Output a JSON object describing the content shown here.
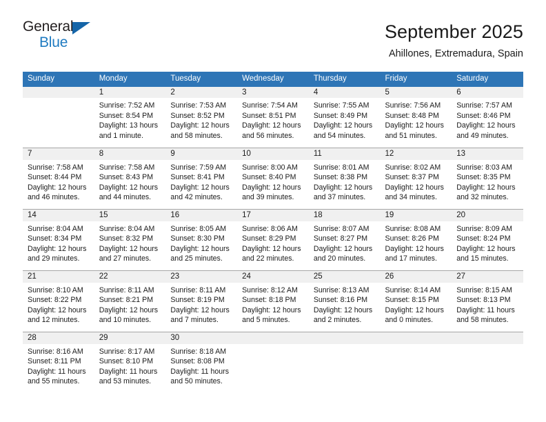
{
  "brand": {
    "line1": "General",
    "line2": "Blue",
    "triangle_icon": "triangle-logo-icon",
    "color_dark": "#231f20",
    "color_blue": "#1f7bc1"
  },
  "header": {
    "title": "September 2025",
    "subtitle": "Ahillones, Extremadura, Spain"
  },
  "colors": {
    "header_blue": "#2e75b6",
    "daynum_band": "#f0f0f0",
    "row_divider": "#a6a6a6"
  },
  "weekday_headers": [
    "Sunday",
    "Monday",
    "Tuesday",
    "Wednesday",
    "Thursday",
    "Friday",
    "Saturday"
  ],
  "weeks": [
    [
      {
        "day": "",
        "lines": []
      },
      {
        "day": "1",
        "lines": [
          "Sunrise: 7:52 AM",
          "Sunset: 8:54 PM",
          "Daylight: 13 hours",
          "and 1 minute."
        ]
      },
      {
        "day": "2",
        "lines": [
          "Sunrise: 7:53 AM",
          "Sunset: 8:52 PM",
          "Daylight: 12 hours",
          "and 58 minutes."
        ]
      },
      {
        "day": "3",
        "lines": [
          "Sunrise: 7:54 AM",
          "Sunset: 8:51 PM",
          "Daylight: 12 hours",
          "and 56 minutes."
        ]
      },
      {
        "day": "4",
        "lines": [
          "Sunrise: 7:55 AM",
          "Sunset: 8:49 PM",
          "Daylight: 12 hours",
          "and 54 minutes."
        ]
      },
      {
        "day": "5",
        "lines": [
          "Sunrise: 7:56 AM",
          "Sunset: 8:48 PM",
          "Daylight: 12 hours",
          "and 51 minutes."
        ]
      },
      {
        "day": "6",
        "lines": [
          "Sunrise: 7:57 AM",
          "Sunset: 8:46 PM",
          "Daylight: 12 hours",
          "and 49 minutes."
        ]
      }
    ],
    [
      {
        "day": "7",
        "lines": [
          "Sunrise: 7:58 AM",
          "Sunset: 8:44 PM",
          "Daylight: 12 hours",
          "and 46 minutes."
        ]
      },
      {
        "day": "8",
        "lines": [
          "Sunrise: 7:58 AM",
          "Sunset: 8:43 PM",
          "Daylight: 12 hours",
          "and 44 minutes."
        ]
      },
      {
        "day": "9",
        "lines": [
          "Sunrise: 7:59 AM",
          "Sunset: 8:41 PM",
          "Daylight: 12 hours",
          "and 42 minutes."
        ]
      },
      {
        "day": "10",
        "lines": [
          "Sunrise: 8:00 AM",
          "Sunset: 8:40 PM",
          "Daylight: 12 hours",
          "and 39 minutes."
        ]
      },
      {
        "day": "11",
        "lines": [
          "Sunrise: 8:01 AM",
          "Sunset: 8:38 PM",
          "Daylight: 12 hours",
          "and 37 minutes."
        ]
      },
      {
        "day": "12",
        "lines": [
          "Sunrise: 8:02 AM",
          "Sunset: 8:37 PM",
          "Daylight: 12 hours",
          "and 34 minutes."
        ]
      },
      {
        "day": "13",
        "lines": [
          "Sunrise: 8:03 AM",
          "Sunset: 8:35 PM",
          "Daylight: 12 hours",
          "and 32 minutes."
        ]
      }
    ],
    [
      {
        "day": "14",
        "lines": [
          "Sunrise: 8:04 AM",
          "Sunset: 8:34 PM",
          "Daylight: 12 hours",
          "and 29 minutes."
        ]
      },
      {
        "day": "15",
        "lines": [
          "Sunrise: 8:04 AM",
          "Sunset: 8:32 PM",
          "Daylight: 12 hours",
          "and 27 minutes."
        ]
      },
      {
        "day": "16",
        "lines": [
          "Sunrise: 8:05 AM",
          "Sunset: 8:30 PM",
          "Daylight: 12 hours",
          "and 25 minutes."
        ]
      },
      {
        "day": "17",
        "lines": [
          "Sunrise: 8:06 AM",
          "Sunset: 8:29 PM",
          "Daylight: 12 hours",
          "and 22 minutes."
        ]
      },
      {
        "day": "18",
        "lines": [
          "Sunrise: 8:07 AM",
          "Sunset: 8:27 PM",
          "Daylight: 12 hours",
          "and 20 minutes."
        ]
      },
      {
        "day": "19",
        "lines": [
          "Sunrise: 8:08 AM",
          "Sunset: 8:26 PM",
          "Daylight: 12 hours",
          "and 17 minutes."
        ]
      },
      {
        "day": "20",
        "lines": [
          "Sunrise: 8:09 AM",
          "Sunset: 8:24 PM",
          "Daylight: 12 hours",
          "and 15 minutes."
        ]
      }
    ],
    [
      {
        "day": "21",
        "lines": [
          "Sunrise: 8:10 AM",
          "Sunset: 8:22 PM",
          "Daylight: 12 hours",
          "and 12 minutes."
        ]
      },
      {
        "day": "22",
        "lines": [
          "Sunrise: 8:11 AM",
          "Sunset: 8:21 PM",
          "Daylight: 12 hours",
          "and 10 minutes."
        ]
      },
      {
        "day": "23",
        "lines": [
          "Sunrise: 8:11 AM",
          "Sunset: 8:19 PM",
          "Daylight: 12 hours",
          "and 7 minutes."
        ]
      },
      {
        "day": "24",
        "lines": [
          "Sunrise: 8:12 AM",
          "Sunset: 8:18 PM",
          "Daylight: 12 hours",
          "and 5 minutes."
        ]
      },
      {
        "day": "25",
        "lines": [
          "Sunrise: 8:13 AM",
          "Sunset: 8:16 PM",
          "Daylight: 12 hours",
          "and 2 minutes."
        ]
      },
      {
        "day": "26",
        "lines": [
          "Sunrise: 8:14 AM",
          "Sunset: 8:15 PM",
          "Daylight: 12 hours",
          "and 0 minutes."
        ]
      },
      {
        "day": "27",
        "lines": [
          "Sunrise: 8:15 AM",
          "Sunset: 8:13 PM",
          "Daylight: 11 hours",
          "and 58 minutes."
        ]
      }
    ],
    [
      {
        "day": "28",
        "lines": [
          "Sunrise: 8:16 AM",
          "Sunset: 8:11 PM",
          "Daylight: 11 hours",
          "and 55 minutes."
        ]
      },
      {
        "day": "29",
        "lines": [
          "Sunrise: 8:17 AM",
          "Sunset: 8:10 PM",
          "Daylight: 11 hours",
          "and 53 minutes."
        ]
      },
      {
        "day": "30",
        "lines": [
          "Sunrise: 8:18 AM",
          "Sunset: 8:08 PM",
          "Daylight: 11 hours",
          "and 50 minutes."
        ]
      },
      {
        "day": "",
        "lines": []
      },
      {
        "day": "",
        "lines": []
      },
      {
        "day": "",
        "lines": []
      },
      {
        "day": "",
        "lines": []
      }
    ]
  ]
}
